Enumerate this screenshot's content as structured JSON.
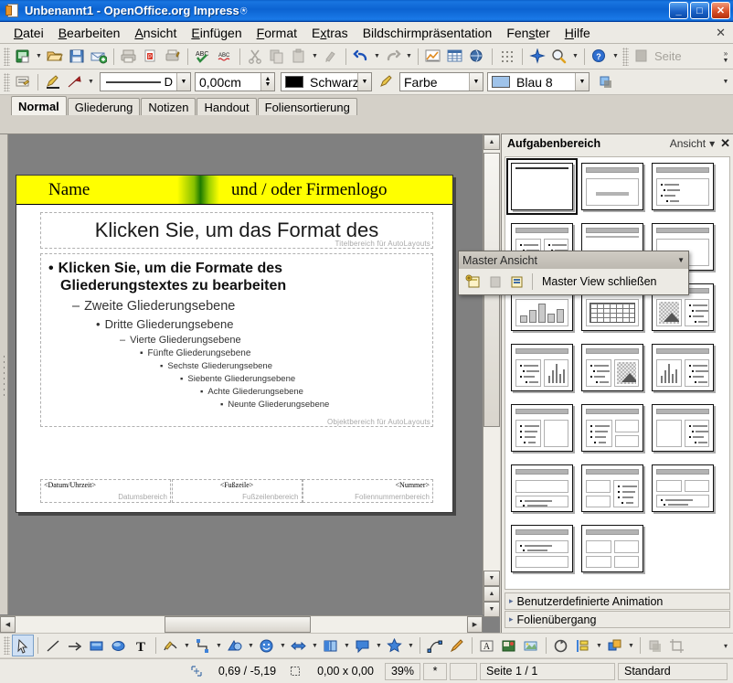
{
  "window": {
    "title": "Unbenannt1 - OpenOffice.org Impress",
    "title_glyph": "⍟",
    "minimize": "_",
    "maximize": "□",
    "close": "✕"
  },
  "menubar": {
    "items": [
      {
        "label": "Datei",
        "accel": "D"
      },
      {
        "label": "Bearbeiten",
        "accel": "B"
      },
      {
        "label": "Ansicht",
        "accel": "A"
      },
      {
        "label": "Einfügen",
        "accel": "E"
      },
      {
        "label": "Format",
        "accel": "F"
      },
      {
        "label": "Extras",
        "accel": "x"
      },
      {
        "label": "Bildschirmpräsentation",
        "accel": "c"
      },
      {
        "label": "Fenster",
        "accel": "s"
      },
      {
        "label": "Hilfe",
        "accel": "H"
      }
    ],
    "close_document": "✕"
  },
  "standard_toolbar": {
    "buttons": [
      "new-document-icon",
      "open-document-icon",
      "save-document-icon",
      "email-document-icon",
      "print-icon",
      "export-pdf-icon",
      "print-preview-icon",
      "spelling-icon",
      "autospellcheck-icon",
      "cut-icon",
      "copy-icon",
      "paste-icon",
      "clone-formatting-icon",
      "undo-icon",
      "redo-icon",
      "chart-icon",
      "table-icon",
      "hyperlink-icon",
      "display-grid-icon",
      "show-draw-functions-icon",
      "zoom-icon",
      "help-icon"
    ],
    "page_button_label": "Seite",
    "overflow": "»"
  },
  "line_fill_toolbar": {
    "style_icon": "line-style-icon",
    "line_color_icon": "line-color-icon",
    "arrow_style_icon": "arrow-style-icon",
    "line_style_value": "D",
    "line_width_value": "0,00cm",
    "line_color_value": "Schwarz",
    "area_style_label": "Farbe",
    "area_color_value": "Blau 8",
    "shadow_icon": "shadow-icon"
  },
  "view_tabs": {
    "items": [
      "Normal",
      "Gliederung",
      "Notizen",
      "Handout",
      "Foliensortierung"
    ],
    "active": "Normal"
  },
  "master_toolbar": {
    "title": "Master Ansicht",
    "dropdown": "▼",
    "buttons": [
      "new-master-icon",
      "rename-master-icon",
      "delete-master-icon"
    ],
    "close_label": "Master View schließen"
  },
  "slide": {
    "banner_name": "Name",
    "banner_logo": "und / oder Firmenlogo",
    "title_text": "Klicken Sie, um das Format des",
    "title_placeholder_label": "Titelbereich für AutoLayouts",
    "outline_placeholder_label": "Objektbereich für AutoLayouts",
    "outline": [
      {
        "bullet": "•",
        "text": "Klicken Sie, um die Formate des"
      },
      {
        "bullet": "",
        "text": "Gliederungstextes zu bearbeiten"
      },
      {
        "bullet": "–",
        "text": "Zweite Gliederungsebene"
      },
      {
        "bullet": "•",
        "text": "Dritte Gliederungsebene"
      },
      {
        "bullet": "–",
        "text": "Vierte Gliederungsebene"
      },
      {
        "bullet": "▪",
        "text": "Fünfte Gliederungsebene"
      },
      {
        "bullet": "▪",
        "text": "Sechste Gliederungsebene"
      },
      {
        "bullet": "▪",
        "text": "Siebente Gliederungsebene"
      },
      {
        "bullet": "▪",
        "text": "Achte Gliederungsebene"
      },
      {
        "bullet": "▪",
        "text": "Neunte Gliederungsebene"
      }
    ],
    "date_field": "<Datum/Uhrzeit>",
    "date_label": "Datumsbereich",
    "footer_field": "<Fußzeile>",
    "footer_label": "Fußzeilenbereich",
    "number_field": "<Nummer>",
    "number_label": "Foliennummernbereich",
    "banner_color": "#ffff00",
    "banner_accent": "#1c7a00"
  },
  "task_pane": {
    "title": "Aufgabenbereich",
    "view_label": "Ansicht",
    "view_caret": "▾",
    "close": "✕",
    "layout_count": 20,
    "selected_layout": 1,
    "sections": [
      {
        "label": "Benutzerdefinierte Animation",
        "expanded": false,
        "arrow": "▸"
      },
      {
        "label": "Folienübergang",
        "expanded": false,
        "arrow": "▸"
      }
    ]
  },
  "draw_toolbar": {
    "buttons": [
      "select-icon",
      "line-icon",
      "arrow-icon",
      "rectangle-icon",
      "ellipse-icon",
      "text-icon",
      "curve-icon",
      "connector-icon",
      "basic-shapes-icon",
      "symbol-shapes-icon",
      "block-arrows-icon",
      "flowchart-icon",
      "callouts-icon",
      "stars-icon",
      "edit-points-icon",
      "glue-points-icon",
      "fontwork-icon",
      "from-file-icon",
      "gallery-icon",
      "rotate-icon",
      "alignment-icon",
      "arrange-icon",
      "shadow-icon",
      "crop-icon"
    ],
    "selected": "select-icon",
    "overflow": "▾"
  },
  "statusbar": {
    "cursor_position": "0,69 / -5,19",
    "object_size": "0,00 x 0,00",
    "zoom": "39%",
    "modified": "*",
    "signature": "",
    "page_info": "Seite 1 / 1",
    "master_name": "Standard"
  }
}
